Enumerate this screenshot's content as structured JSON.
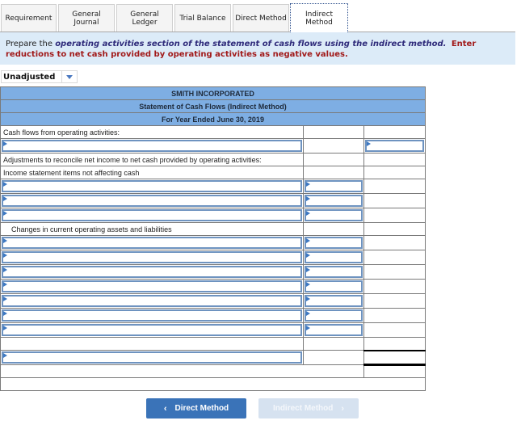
{
  "tabs": [
    {
      "label": "Requirement",
      "active": false
    },
    {
      "label": "General\nJournal",
      "active": false
    },
    {
      "label": "General\nLedger",
      "active": false
    },
    {
      "label": "Trial Balance",
      "active": false
    },
    {
      "label": "Direct Method",
      "active": false
    },
    {
      "label": "Indirect\nMethod",
      "active": true
    }
  ],
  "instructions": {
    "prefix": "Prepare the ",
    "emphasis": "operating activities section of the statement of cash flows using the indirect method.",
    "warning": "Enter reductions to net cash provided by operating activities as negative values."
  },
  "dropdown": {
    "selected": "Unadjusted",
    "icon": "chevron-down-icon"
  },
  "statement": {
    "company": "SMITH INCORPORATED",
    "title": "Statement of Cash Flows (Indirect Method)",
    "period": "For Year Ended June 30, 2019",
    "labels": {
      "operating": "Cash flows from operating activities:",
      "adjustments": "Adjustments to reconcile net income to net cash provided by operating activities:",
      "income_items": "Income statement items not affecting cash",
      "changes": "Changes in current operating assets and liabilities"
    },
    "net_income_row": {
      "label": "",
      "amount": ""
    },
    "income_item_rows": [
      {
        "label": "",
        "amount": ""
      },
      {
        "label": "",
        "amount": ""
      },
      {
        "label": "",
        "amount": ""
      }
    ],
    "change_rows": [
      {
        "label": "",
        "amount": ""
      },
      {
        "label": "",
        "amount": ""
      },
      {
        "label": "",
        "amount": ""
      },
      {
        "label": "",
        "amount": ""
      },
      {
        "label": "",
        "amount": ""
      },
      {
        "label": "",
        "amount": ""
      },
      {
        "label": "",
        "amount": ""
      }
    ],
    "total_row": {
      "label": "",
      "total": ""
    }
  },
  "nav": {
    "prev_label": "Direct Method",
    "next_label": "Indirect Method",
    "prev_icon": "chevron-left-icon",
    "next_icon": "chevron-right-icon"
  },
  "colors": {
    "header_bg": "#7eaee3",
    "instruction_bg": "#dcebf8",
    "input_border": "#6e93c0",
    "primary_button": "#3a73b8",
    "disabled_button": "#d6e2f0",
    "warning_text": "#a11a1a",
    "emphasis_text": "#2e2a7a"
  }
}
